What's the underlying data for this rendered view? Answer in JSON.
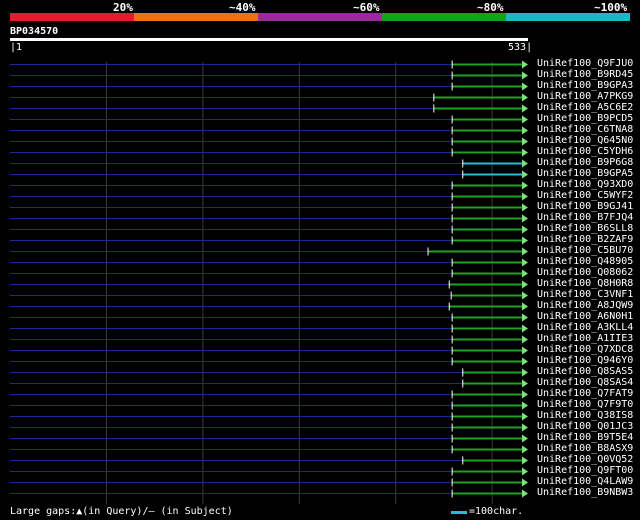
{
  "legend": {
    "labels": [
      "20%",
      "~40%",
      "~60%",
      "~80%",
      "~100%"
    ],
    "colors": [
      "#e8192c",
      "#e5731e",
      "#9b2b9a",
      "#18a11a",
      "#1ab7c9"
    ]
  },
  "query": {
    "id": "BP034570",
    "start": "1",
    "end": "533"
  },
  "colors": {
    "background": "#000000",
    "gap_line": "#1a2a8c",
    "grid": "#3a3a3a",
    "hit_green": "#22a022",
    "hit_cyan": "#28bcd4",
    "arrow": "#7ce07c"
  },
  "hits": [
    {
      "name": "UniRef100_Q9FJU0",
      "start": 459,
      "end": 533,
      "color": "green"
    },
    {
      "name": "UniRef100_B9RD45",
      "start": 459,
      "end": 533,
      "color": "green"
    },
    {
      "name": "UniRef100_B9GPA3",
      "start": 459,
      "end": 533,
      "color": "green"
    },
    {
      "name": "UniRef100_A7PKG9",
      "start": 440,
      "end": 533,
      "color": "green"
    },
    {
      "name": "UniRef100_A5C6E2",
      "start": 440,
      "end": 533,
      "color": "green"
    },
    {
      "name": "UniRef100_B9PCD5",
      "start": 459,
      "end": 533,
      "color": "green"
    },
    {
      "name": "UniRef100_C6TNA8",
      "start": 459,
      "end": 533,
      "color": "green"
    },
    {
      "name": "UniRef100_Q645N0",
      "start": 459,
      "end": 533,
      "color": "green"
    },
    {
      "name": "UniRef100_C5YDH6",
      "start": 459,
      "end": 533,
      "color": "green"
    },
    {
      "name": "UniRef100_B9P6G8",
      "start": 470,
      "end": 533,
      "color": "cyan"
    },
    {
      "name": "UniRef100_B9GPA5",
      "start": 470,
      "end": 533,
      "color": "cyan"
    },
    {
      "name": "UniRef100_Q93XD0",
      "start": 459,
      "end": 533,
      "color": "green"
    },
    {
      "name": "UniRef100_C5WYF2",
      "start": 459,
      "end": 533,
      "color": "green"
    },
    {
      "name": "UniRef100_B9GJ41",
      "start": 459,
      "end": 533,
      "color": "green"
    },
    {
      "name": "UniRef100_B7FJQ4",
      "start": 459,
      "end": 533,
      "color": "green"
    },
    {
      "name": "UniRef100_B6SLL8",
      "start": 459,
      "end": 533,
      "color": "green"
    },
    {
      "name": "UniRef100_B2ZAF9",
      "start": 459,
      "end": 533,
      "color": "green"
    },
    {
      "name": "UniRef100_C5BU70",
      "start": 434,
      "end": 533,
      "color": "green"
    },
    {
      "name": "UniRef100_Q48905",
      "start": 459,
      "end": 533,
      "color": "green"
    },
    {
      "name": "UniRef100_Q08062",
      "start": 459,
      "end": 533,
      "color": "green"
    },
    {
      "name": "UniRef100_Q8H0R8",
      "start": 456,
      "end": 533,
      "color": "green"
    },
    {
      "name": "UniRef100_C3VNF1",
      "start": 458,
      "end": 533,
      "color": "green"
    },
    {
      "name": "UniRef100_A8JQW9",
      "start": 456,
      "end": 533,
      "color": "green"
    },
    {
      "name": "UniRef100_A6N0H1",
      "start": 459,
      "end": 533,
      "color": "green"
    },
    {
      "name": "UniRef100_A3KLL4",
      "start": 459,
      "end": 533,
      "color": "green"
    },
    {
      "name": "UniRef100_A1IIE3",
      "start": 459,
      "end": 533,
      "color": "green"
    },
    {
      "name": "UniRef100_Q7XDC8",
      "start": 459,
      "end": 533,
      "color": "green"
    },
    {
      "name": "UniRef100_Q946Y0",
      "start": 459,
      "end": 533,
      "color": "green"
    },
    {
      "name": "UniRef100_Q8SAS5",
      "start": 470,
      "end": 533,
      "color": "green"
    },
    {
      "name": "UniRef100_Q8SAS4",
      "start": 470,
      "end": 533,
      "color": "green"
    },
    {
      "name": "UniRef100_Q7FAT9",
      "start": 459,
      "end": 533,
      "color": "green"
    },
    {
      "name": "UniRef100_Q7F9T0",
      "start": 459,
      "end": 533,
      "color": "green"
    },
    {
      "name": "UniRef100_Q38IS8",
      "start": 459,
      "end": 533,
      "color": "green"
    },
    {
      "name": "UniRef100_Q01JC3",
      "start": 459,
      "end": 533,
      "color": "green"
    },
    {
      "name": "UniRef100_B9T5E4",
      "start": 459,
      "end": 533,
      "color": "green"
    },
    {
      "name": "UniRef100_B8ASX9",
      "start": 459,
      "end": 533,
      "color": "green"
    },
    {
      "name": "UniRef100_Q0VQ52",
      "start": 470,
      "end": 533,
      "color": "green"
    },
    {
      "name": "UniRef100_Q9FT00",
      "start": 459,
      "end": 533,
      "color": "green"
    },
    {
      "name": "UniRef100_Q4LAW9",
      "start": 459,
      "end": 533,
      "color": "green"
    },
    {
      "name": "UniRef100_B9NBW3",
      "start": 459,
      "end": 533,
      "color": "green"
    }
  ],
  "footer": {
    "note": "Large gaps:▲(in Query)/– (in Subject)",
    "scale_label": "=100char."
  }
}
